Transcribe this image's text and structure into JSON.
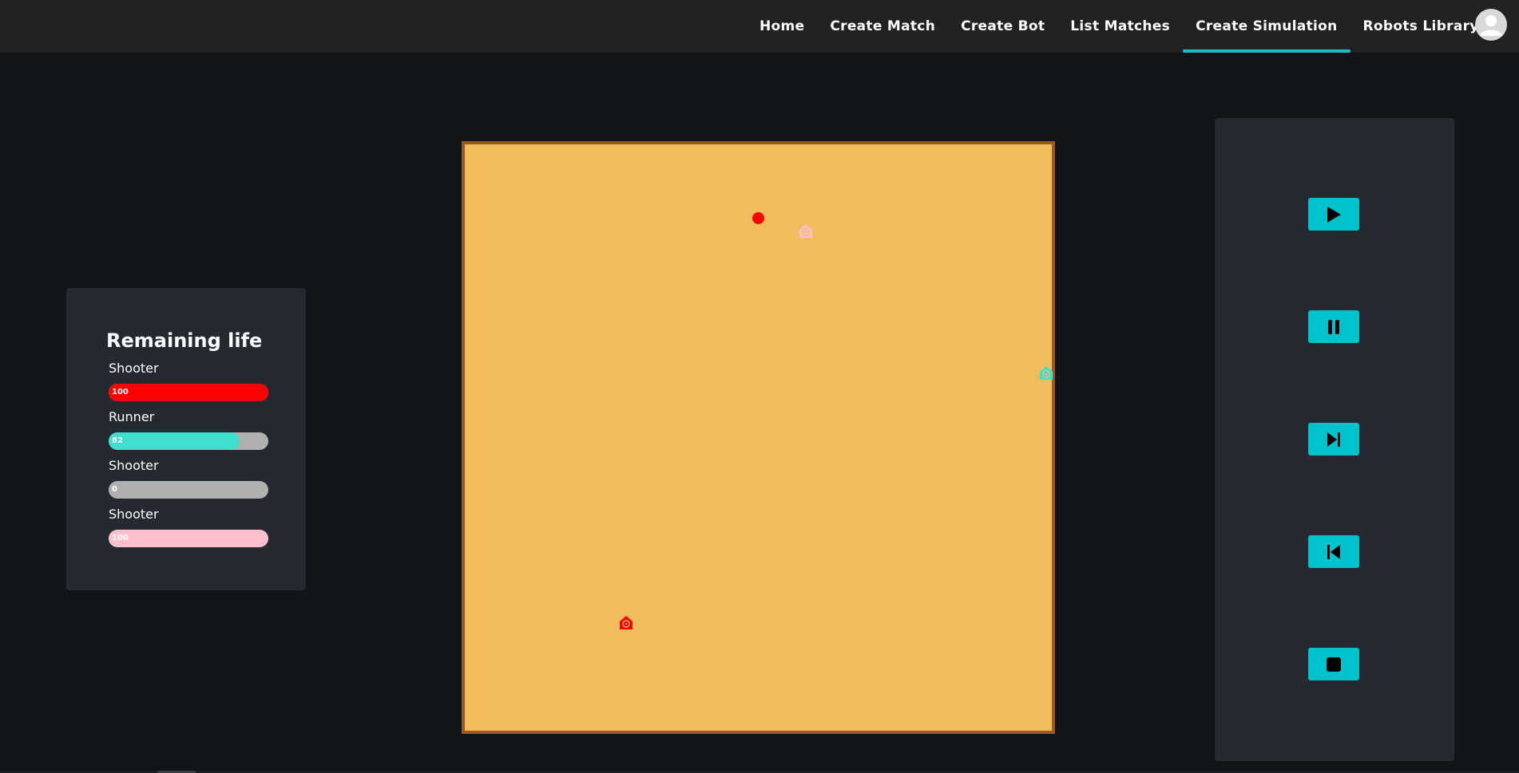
{
  "nav": {
    "items": [
      {
        "label": "Home",
        "active": false
      },
      {
        "label": "Create Match",
        "active": false
      },
      {
        "label": "Create Bot",
        "active": false
      },
      {
        "label": "List Matches",
        "active": false
      },
      {
        "label": "Create Simulation",
        "active": true
      },
      {
        "label": "Robots Library",
        "active": false
      }
    ],
    "accent_color": "#1cbfc9",
    "avatar_icon": "user-icon"
  },
  "life_panel": {
    "title": "Remaining life",
    "robots": [
      {
        "name": "Shooter",
        "life": 100,
        "life_label": "100",
        "color": "#ff0000"
      },
      {
        "name": "Runner",
        "life": 82,
        "life_label": "82",
        "color": "#3fdfcf"
      },
      {
        "name": "Shooter",
        "life": 0,
        "life_label": "0",
        "color": "#b0b0b0"
      },
      {
        "name": "Shooter",
        "life": 100,
        "life_label": "100",
        "color": "#ffc0cb"
      }
    ]
  },
  "arena": {
    "background": "#f1bc5b",
    "border_color": "#9a5a24"
  },
  "controls": {
    "button_color": "#00c2cc",
    "buttons": [
      {
        "icon": "play-icon"
      },
      {
        "icon": "pause-icon"
      },
      {
        "icon": "step-forward-icon"
      },
      {
        "icon": "step-back-icon"
      },
      {
        "icon": "stop-icon"
      }
    ]
  }
}
